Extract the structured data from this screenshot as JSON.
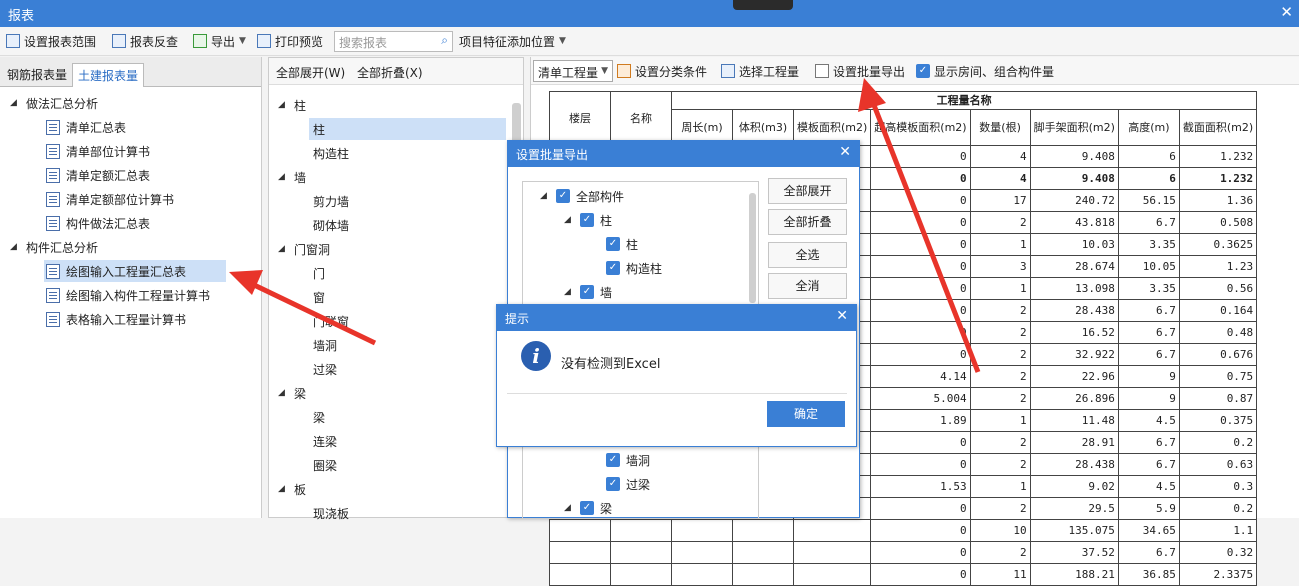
{
  "window": {
    "title": "报表"
  },
  "toolbar": {
    "set_range": "设置报表范围",
    "check": "报表反查",
    "export": "导出",
    "print_preview": "打印预览",
    "search_placeholder": "搜索报表",
    "feature_position": "项目特征添加位置"
  },
  "left_tabs": [
    "钢筋报表量",
    "土建报表量"
  ],
  "left_tree": {
    "group1": "做法汇总分析",
    "group1_items": [
      "清单汇总表",
      "清单部位计算书",
      "清单定额汇总表",
      "清单定额部位计算书",
      "构件做法汇总表"
    ],
    "group2": "构件汇总分析",
    "group2_items": [
      "绘图输入工程量汇总表",
      "绘图输入构件工程量计算书",
      "表格输入工程量计算书"
    ]
  },
  "mid_bar": {
    "expand_all": "全部展开(W)",
    "collapse_all": "全部折叠(X)"
  },
  "mid_tree": {
    "g1": "柱",
    "g1_items": [
      "柱",
      "构造柱"
    ],
    "g2": "墙",
    "g2_items": [
      "剪力墙",
      "砌体墙"
    ],
    "g3": "门窗洞",
    "g3_items": [
      "门",
      "窗",
      "门联窗",
      "墙洞",
      "过梁"
    ],
    "g4": "梁",
    "g4_items": [
      "梁",
      "连梁",
      "圈梁"
    ],
    "g5": "板",
    "g5_items": [
      "现浇板"
    ]
  },
  "right_bar": {
    "combo": "清单工程量",
    "classify": "设置分类条件",
    "select_qty": "选择工程量",
    "batch_export": "设置批量导出",
    "show_room": "显示房间、组合构件量"
  },
  "table": {
    "h_floor": "楼层",
    "h_name": "名称",
    "h_group": "工程量名称",
    "cols": [
      "周长(m)",
      "体积(m3)",
      "模板面积(m2)",
      "超高模板面积(m2)",
      "数量(根)",
      "脚手架面积(m2)",
      "高度(m)",
      "截面面积(m2)"
    ],
    "rows": [
      [
        "0",
        "4",
        "9.408",
        "6",
        "1.232"
      ],
      [
        "0",
        "4",
        "9.408",
        "6",
        "1.232"
      ],
      [
        "0",
        "17",
        "240.72",
        "56.15",
        "1.36"
      ],
      [
        "0",
        "2",
        "43.818",
        "6.7",
        "0.508"
      ],
      [
        "0",
        "1",
        "10.03",
        "3.35",
        "0.3625"
      ],
      [
        "0",
        "3",
        "28.674",
        "10.05",
        "1.23"
      ],
      [
        "0",
        "1",
        "13.098",
        "3.35",
        "0.56"
      ],
      [
        "0",
        "2",
        "28.438",
        "6.7",
        "0.164"
      ],
      [
        "0",
        "2",
        "16.52",
        "6.7",
        "0.48"
      ],
      [
        "0",
        "2",
        "32.922",
        "6.7",
        "0.676"
      ],
      [
        "4.14",
        "2",
        "22.96",
        "9",
        "0.75"
      ],
      [
        "5.004",
        "2",
        "26.896",
        "9",
        "0.87"
      ],
      [
        "1.89",
        "1",
        "11.48",
        "4.5",
        "0.375"
      ],
      [
        "0",
        "2",
        "28.91",
        "6.7",
        "0.2"
      ],
      [
        "0",
        "2",
        "28.438",
        "6.7",
        "0.63"
      ],
      [
        "1.53",
        "1",
        "9.02",
        "4.5",
        "0.3"
      ],
      [
        "0",
        "2",
        "29.5",
        "5.9",
        "0.2"
      ],
      [
        "0",
        "10",
        "135.075",
        "34.65",
        "1.1"
      ],
      [
        "0",
        "2",
        "37.52",
        "6.7",
        "0.32"
      ],
      [
        "0",
        "11",
        "188.21",
        "36.85",
        "2.3375"
      ]
    ]
  },
  "batch_dialog": {
    "title": "设置批量导出",
    "tree": [
      "全部构件",
      "柱",
      "柱",
      "构造柱",
      "墙",
      "墙洞",
      "过梁",
      "梁"
    ],
    "buttons": [
      "全部展开",
      "全部折叠",
      "全选",
      "全消"
    ]
  },
  "alert": {
    "title": "提示",
    "message": "没有检测到Excel",
    "ok": "确定"
  },
  "colors": {
    "accent": "#3a7fd5",
    "arrow": "#e8342a"
  }
}
